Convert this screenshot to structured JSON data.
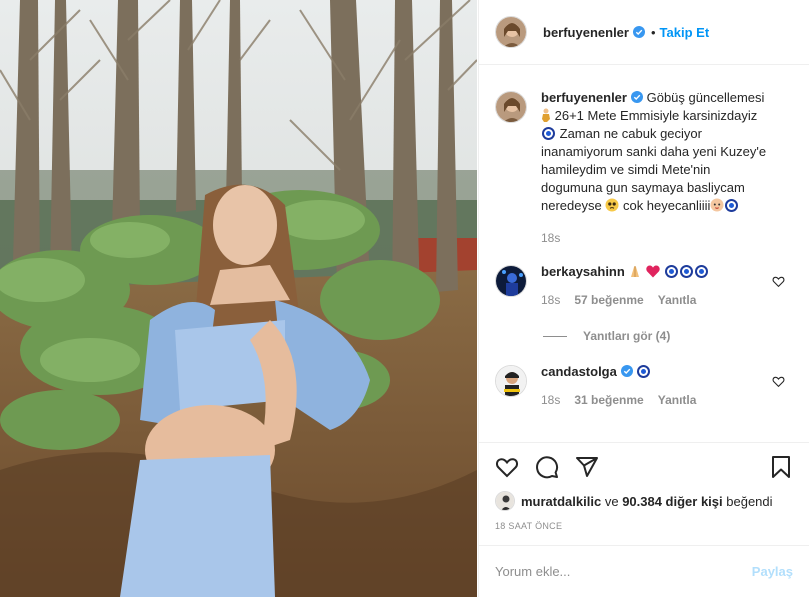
{
  "post": {
    "photo_alt": "",
    "author": "berfuyenenler",
    "follow_label": "Takip Et",
    "dot": "•"
  },
  "caption": {
    "author": "berfuyenenler",
    "text_1": "Göbüş güncellemesi",
    "text_2": "26+1 Mete Emmisiyle karsinizdayiz",
    "text_3": "Zaman ne cabuk geciyor inanamiyorum sanki daha yeni Kuzey'e hamileydim ve simdi Mete'nin dogumuna gun saymaya basliycam neredeyse",
    "text_4": "cok heyecanliiii",
    "time": "18s"
  },
  "comments": [
    {
      "author": "berkaysahinn",
      "time": "18s",
      "likes": "57 beğenme",
      "reply_label": "Yanıtla",
      "view_replies": "Yanıtları gör (4)"
    },
    {
      "author": "candastolga",
      "time": "18s",
      "likes": "31 beğenme",
      "reply_label": "Yanıtla"
    }
  ],
  "liked_by": {
    "user": "muratdalkilic",
    "connector": "ve",
    "others": "90.384 diğer kişi",
    "suffix": "beğendi"
  },
  "timestamp": "18 SAAT ÖNCE",
  "composer": {
    "placeholder": "Yorum ekle...",
    "post_label": "Paylaş"
  },
  "icons": {
    "like": "heart-icon",
    "comment": "comment-icon",
    "share": "share-icon",
    "save": "bookmark-icon",
    "verified": "verified-badge-icon"
  },
  "colors": {
    "accent": "#0095f6",
    "verified": "#3897f0",
    "muted": "#8e8e8e",
    "post_disabled": "#b2dffc"
  }
}
